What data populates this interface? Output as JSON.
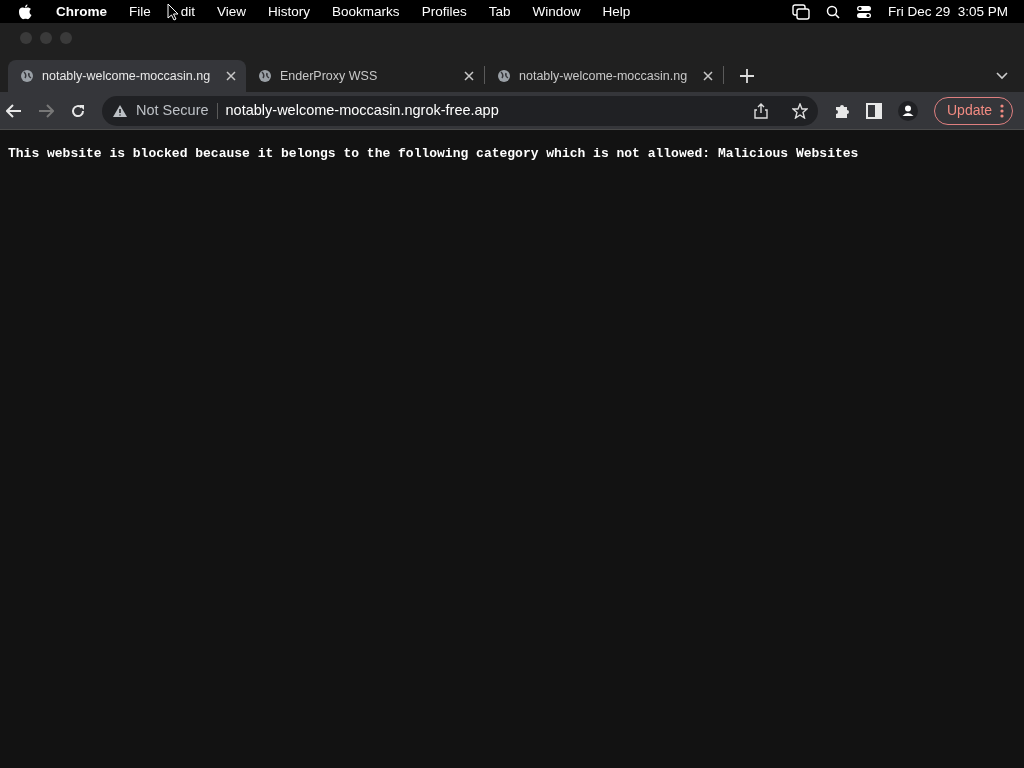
{
  "menu_bar": {
    "app_name": "Chrome",
    "items": [
      "File",
      "dit",
      "View",
      "History",
      "Bookmarks",
      "Profiles",
      "Tab",
      "Window",
      "Help"
    ],
    "clock": "Fri Dec 29  3:05 PM"
  },
  "tabs": [
    {
      "title": "notably-welcome-moccasin.ng",
      "selected": true
    },
    {
      "title": "EnderProxy WSS",
      "selected": false
    },
    {
      "title": "notably-welcome-moccasin.ng",
      "selected": false
    }
  ],
  "toolbar": {
    "security": "Not Secure",
    "url": "notably-welcome-moccasin.ngrok-free.app",
    "update_button": "Update"
  },
  "page": {
    "message": "This website is blocked because it belongs to the following category which is not allowed: Malicious Websites"
  }
}
